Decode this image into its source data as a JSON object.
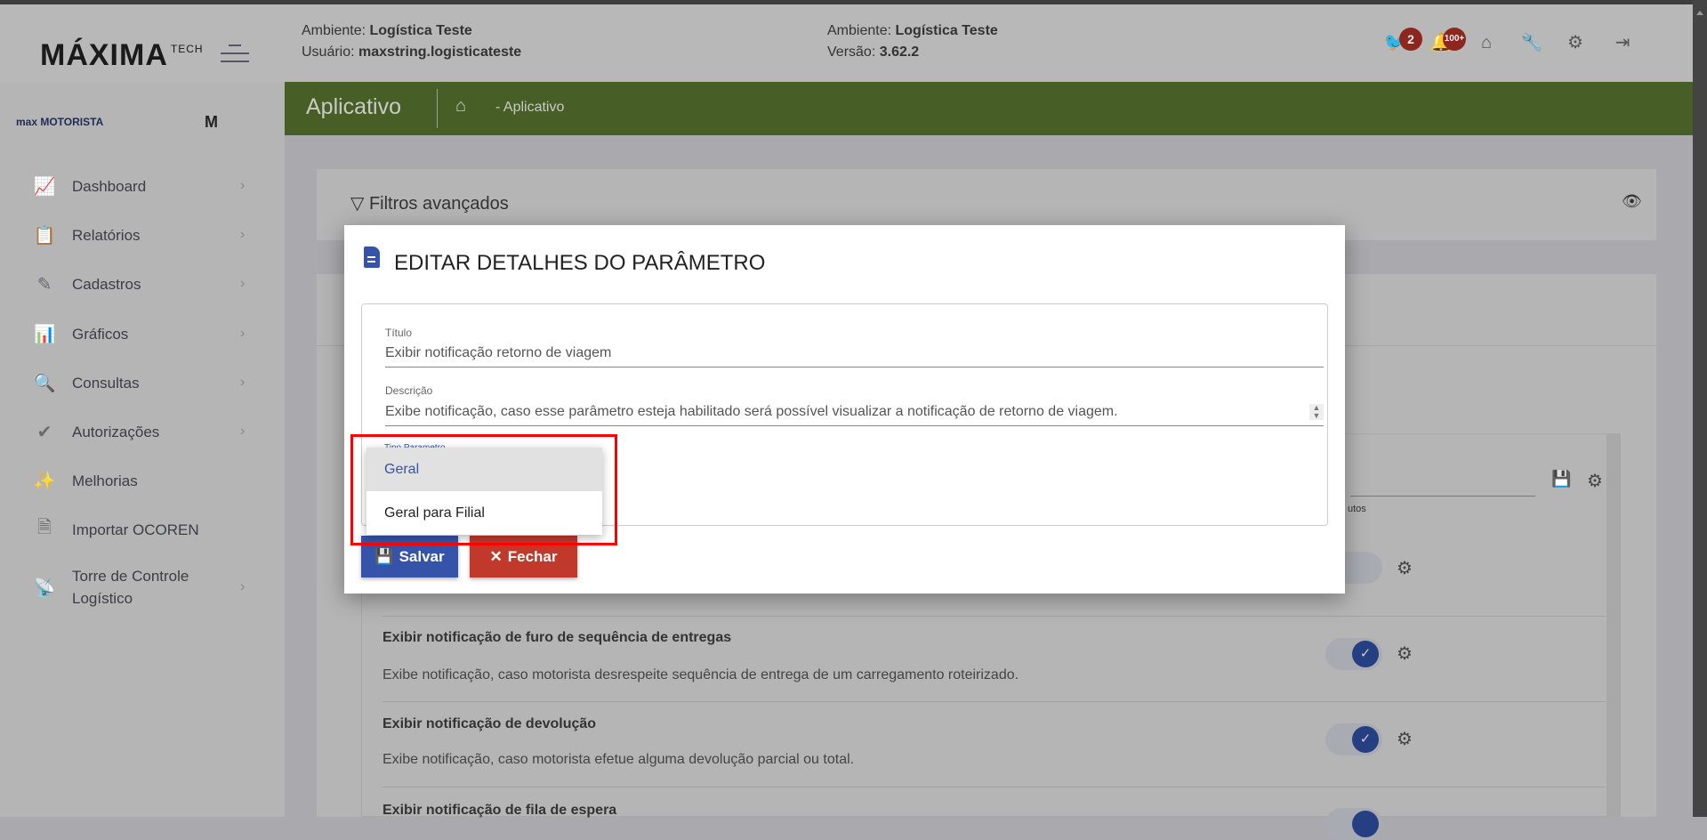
{
  "header": {
    "logo": "MÁXIMA",
    "logo_sup": "TECH",
    "left": {
      "env_label": "Ambiente:",
      "env": "Logística Teste",
      "user_label": "Usuário:",
      "user": "maxstring.logisticateste"
    },
    "center": {
      "env_label": "Ambiente:",
      "env": "Logística Teste",
      "version_label": "Versão:",
      "version": "3.62.2"
    },
    "badges": {
      "bird": "2",
      "bell": "100+"
    },
    "icons": [
      "bird-icon",
      "bell-icon",
      "home-icon",
      "wrench-icon",
      "gear-icon",
      "logout-icon"
    ]
  },
  "sidebar": {
    "brand": "max MOTORISTA",
    "brand_short": "M",
    "items": [
      {
        "label": "Dashboard",
        "icon": "chart-board-icon"
      },
      {
        "label": "Relatórios",
        "icon": "clipboard-icon"
      },
      {
        "label": "Cadastros",
        "icon": "pencil-icon"
      },
      {
        "label": "Gráficos",
        "icon": "bar-chart-icon"
      },
      {
        "label": "Consultas",
        "icon": "search-icon"
      },
      {
        "label": "Autorizações",
        "icon": "double-check-icon"
      },
      {
        "label": "Melhorias",
        "icon": "magic-wand-icon"
      },
      {
        "label": "Importar OCOREN",
        "icon": "document-icon"
      },
      {
        "label": "Torre de Controle Logístico",
        "icon": "antenna-icon"
      }
    ]
  },
  "page": {
    "title": "Aplicativo",
    "breadcrumb": "- Aplicativo"
  },
  "filters": {
    "title": "Filtros avançados"
  },
  "list": {
    "column_partial": "utos",
    "rows": [
      {
        "title": "Exibir notificação de furo de sequência de entregas",
        "desc": "Exibe notificação, caso motorista desrespeite sequência de entrega de um carregamento roteirizado.",
        "enabled": true
      },
      {
        "title": "Exibir notificação de devolução",
        "desc": "Exibe notificação, caso motorista efetue alguma devolução parcial ou total.",
        "enabled": true
      },
      {
        "title": "Exibir notificação de fila de espera",
        "desc": "",
        "enabled": true
      }
    ]
  },
  "modal": {
    "title": "EDITAR DETALHES DO PARÂMETRO",
    "fields": {
      "titulo_label": "Título",
      "titulo_value": "Exibir notificação retorno de viagem",
      "descricao_label": "Descrição",
      "descricao_value": "Exibe notificação, caso esse parâmetro esteja habilitado será possível visualizar a notificação de retorno de viagem.",
      "tipo_label": "Tipo Parametro"
    },
    "dropdown": {
      "options": [
        "Geral",
        "Geral para Filial"
      ],
      "selected": "Geral"
    },
    "save_label": "Salvar",
    "close_label": "Fechar"
  },
  "colors": {
    "accent": "#3553a8",
    "header_green": "#475f27",
    "danger": "#c0392b",
    "highlight": "#ff0000"
  }
}
